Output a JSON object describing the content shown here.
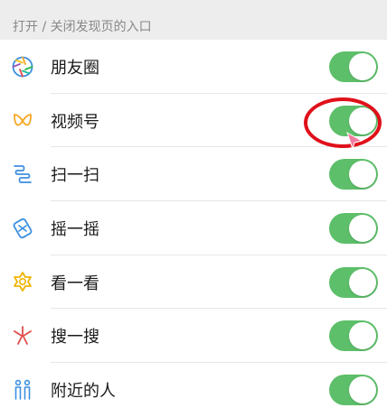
{
  "section_title": "打开 / 关闭发现页的入口",
  "items": [
    {
      "label": "朋友圈",
      "icon": "moments-icon",
      "enabled": true
    },
    {
      "label": "视频号",
      "icon": "channels-icon",
      "enabled": true
    },
    {
      "label": "扫一扫",
      "icon": "scan-icon",
      "enabled": true
    },
    {
      "label": "摇一摇",
      "icon": "shake-icon",
      "enabled": true
    },
    {
      "label": "看一看",
      "icon": "top-stories-icon",
      "enabled": true
    },
    {
      "label": "搜一搜",
      "icon": "search-icon",
      "enabled": true
    },
    {
      "label": "附近的人",
      "icon": "people-nearby-icon",
      "enabled": true
    }
  ],
  "colors": {
    "toggle_on": "#5dbf6a",
    "header_bg": "#ededed",
    "annotation": "#e0101a"
  }
}
